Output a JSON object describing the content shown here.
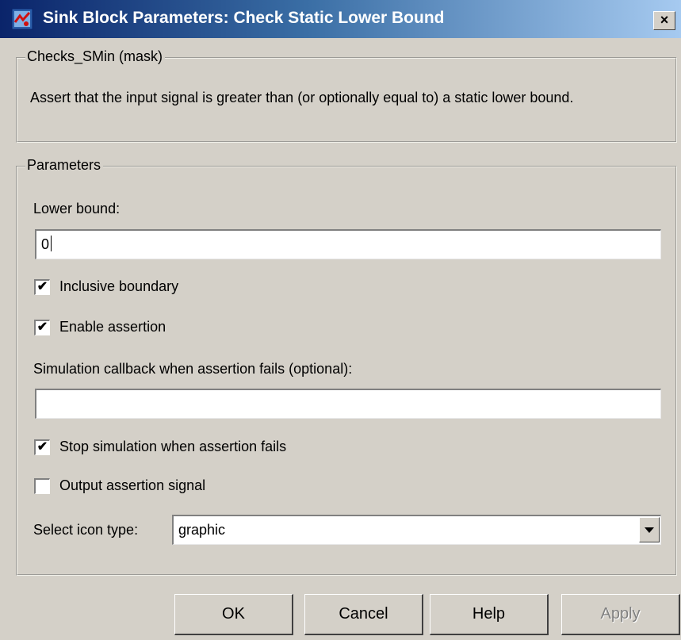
{
  "window": {
    "title": "Sink Block Parameters: Check Static Lower Bound",
    "close_glyph": "×"
  },
  "mask_group": {
    "legend": "Checks_SMin (mask)",
    "description": "Assert that the input signal is greater than (or optionally equal to) a static lower bound."
  },
  "params_group": {
    "legend": "Parameters",
    "lower_bound_label": "Lower bound:",
    "lower_bound_value": "0",
    "inclusive_label": "Inclusive boundary",
    "inclusive_checked": true,
    "enable_label": "Enable assertion",
    "enable_checked": true,
    "callback_label": "Simulation callback when assertion fails (optional):",
    "callback_value": "",
    "stop_label": "Stop simulation when assertion fails",
    "stop_checked": true,
    "output_label": "Output assertion signal",
    "output_checked": false,
    "icon_type_label": "Select icon type:",
    "icon_type_value": "graphic"
  },
  "buttons": {
    "ok": "OK",
    "cancel": "Cancel",
    "help": "Help",
    "apply": "Apply"
  },
  "icons": {
    "app": "simulink-block-icon",
    "close": "close-icon",
    "check": "checkmark-icon",
    "dropdown": "chevron-down-icon"
  },
  "colors": {
    "face": "#d4d0c8",
    "title_start": "#0a246a",
    "title_end": "#a6caf0"
  }
}
